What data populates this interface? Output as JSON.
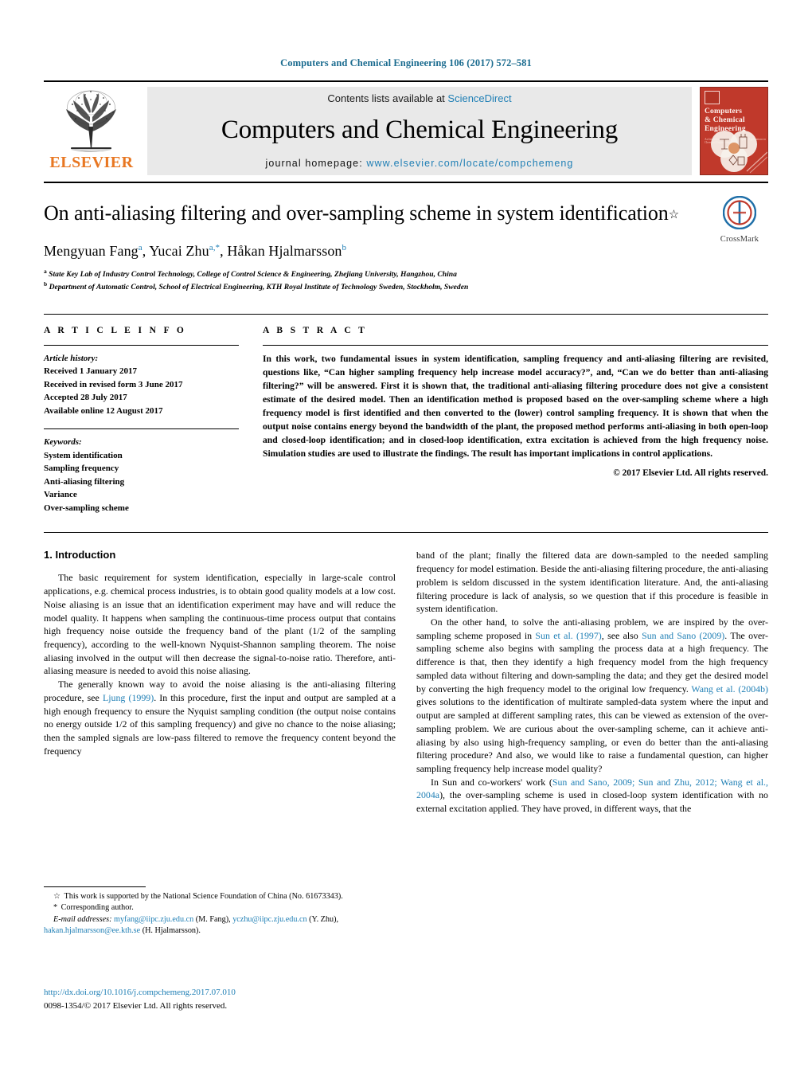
{
  "running_head": "Computers and Chemical Engineering 106 (2017) 572–581",
  "masthead": {
    "publisher_name": "ELSEVIER",
    "contents_prefix": "Contents lists available at ",
    "contents_link": "ScienceDirect",
    "journal_title": "Computers and Chemical Engineering",
    "homepage_prefix": "journal homepage: ",
    "homepage_url": "www.elsevier.com/locate/compchemeng",
    "cover": {
      "line1": "Computers",
      "line2": "& Chemical",
      "line3": "Engineering",
      "subtitle": "An International Journal of Computer Applications in Chemical Engineering"
    }
  },
  "article": {
    "title": "On anti-aliasing filtering and over-sampling scheme in system identification",
    "title_footnote_marker": "☆",
    "authors": [
      {
        "name": "Mengyuan Fang",
        "sup": "a"
      },
      {
        "name": "Yucai Zhu",
        "sup": "a,*"
      },
      {
        "name": "Håkan Hjalmarsson",
        "sup": "b"
      }
    ],
    "affiliations": [
      {
        "marker": "a",
        "text": "State Key Lab of Industry Control Technology, College of Control Science & Engineering, Zhejiang University, Hangzhou, China"
      },
      {
        "marker": "b",
        "text": "Department of Automatic Control, School of Electrical Engineering, KTH Royal Institute of Technology Sweden, Stockholm, Sweden"
      }
    ],
    "crossmark_label": "CrossMark"
  },
  "article_info": {
    "heading": "A R T I C L E    I N F O",
    "history_label": "Article history:",
    "history": [
      "Received 1 January 2017",
      "Received in revised form 3 June 2017",
      "Accepted 28 July 2017",
      "Available online 12 August 2017"
    ],
    "keywords_label": "Keywords:",
    "keywords": [
      "System identification",
      "Sampling frequency",
      "Anti-aliasing filtering",
      "Variance",
      "Over-sampling scheme"
    ]
  },
  "abstract": {
    "heading": "A B S T R A C T",
    "text": "In this work, two fundamental issues in system identification, sampling frequency and anti-aliasing filtering are revisited, questions like, “Can higher sampling frequency help increase model accuracy?”, and, “Can we do better than anti-aliasing filtering?” will be answered. First it is shown that, the traditional anti-aliasing filtering procedure does not give a consistent estimate of the desired model. Then an identification method is proposed based on the over-sampling scheme where a high frequency model is first identified and then converted to the (lower) control sampling frequency. It is shown that when the output noise contains energy beyond the bandwidth of the plant, the proposed method performs anti-aliasing in both open-loop and closed-loop identification; and in closed-loop identification, extra excitation is achieved from the high frequency noise. Simulation studies are used to illustrate the findings. The result has important implications in control applications.",
    "copyright": "© 2017 Elsevier Ltd. All rights reserved."
  },
  "introduction": {
    "heading": "1.  Introduction",
    "left_paragraphs": [
      "The basic requirement for system identification, especially in large-scale control applications, e.g. chemical process industries, is to obtain good quality models at a low cost. Noise aliasing is an issue that an identification experiment may have and will reduce the model quality. It happens when sampling the continuous-time process output that contains high frequency noise outside the frequency band of the plant (1/2 of the sampling frequency), according to the well-known Nyquist-Shannon sampling theorem. The noise aliasing involved in the output will then decrease the signal-to-noise ratio. Therefore, anti-aliasing measure is needed to avoid this noise aliasing."
    ],
    "left_para2_a": "The generally known way to avoid the noise aliasing is the anti-aliasing filtering procedure, see ",
    "left_para2_ref": "Ljung (1999)",
    "left_para2_b": ". In this procedure, first the input and output are sampled at a high enough frequency to ensure the Nyquist sampling condition (the output noise contains no energy outside 1/2 of this sampling frequency) and give no chance to the noise aliasing; then the sampled signals are low-pass filtered to remove the frequency content beyond the frequency",
    "right_para1": "band of the plant; finally the filtered data are down-sampled to the needed sampling frequency for model estimation. Beside the anti-aliasing filtering procedure, the anti-aliasing problem is seldom discussed in the system identification literature. And, the anti-aliasing filtering procedure is lack of analysis, so we question that if this procedure is feasible in system identification.",
    "right_para2_a": "On the other hand, to solve the anti-aliasing problem, we are inspired by the over-sampling scheme proposed in ",
    "right_para2_ref1": "Sun et al. (1997)",
    "right_para2_b": ", see also ",
    "right_para2_ref2": "Sun and Sano (2009)",
    "right_para2_c": ". The over-sampling scheme also begins with sampling the process data at a high frequency. The difference is that, then they identify a high frequency model from the high frequency sampled data without filtering and down-sampling the data; and they get the desired model by converting the high frequency model to the original low frequency. ",
    "right_para2_ref3": "Wang et al. (2004b)",
    "right_para2_d": " gives solutions to the identification of multirate sampled-data system where the input and output are sampled at different sampling rates, this can be viewed as extension of the over-sampling problem. We are curious about the over-sampling scheme, can it achieve anti-aliasing by also using high-frequency sampling, or even do better than the anti-aliasing filtering procedure? And also, we would like to raise a fundamental question, can higher sampling frequency help increase model quality?",
    "right_para3_a": "In Sun and co-workers' work (",
    "right_para3_ref": "Sun and Sano, 2009; Sun and Zhu, 2012; Wang et al., 2004a",
    "right_para3_b": "), the over-sampling scheme is used in closed-loop system identification with no external excitation applied. They have proved, in different ways, that the"
  },
  "footnotes": {
    "funding_marker": "☆",
    "funding_text": "This work is supported by the National Science Foundation of China (No. 61673343).",
    "corresponding_marker": "*",
    "corresponding_text": "Corresponding author.",
    "email_label": "E-mail addresses:",
    "emails": [
      {
        "address": "myfang@iipc.zju.edu.cn",
        "owner": "(M. Fang)"
      },
      {
        "address": "yczhu@iipc.zju.edu.cn",
        "owner": "(Y. Zhu)"
      },
      {
        "address": "hakan.hjalmarsson@ee.kth.se",
        "owner": "(H. Hjalmarsson)"
      }
    ],
    "doi": "http://dx.doi.org/10.1016/j.compchemeng.2017.07.010",
    "issn_line": "0098-1354/© 2017 Elsevier Ltd. All rights reserved."
  },
  "colors": {
    "link_blue": "#1f7fb5",
    "header_blue": "#1a6b8f",
    "elsevier_orange": "#E87722",
    "cover_red": "#c0392b"
  }
}
